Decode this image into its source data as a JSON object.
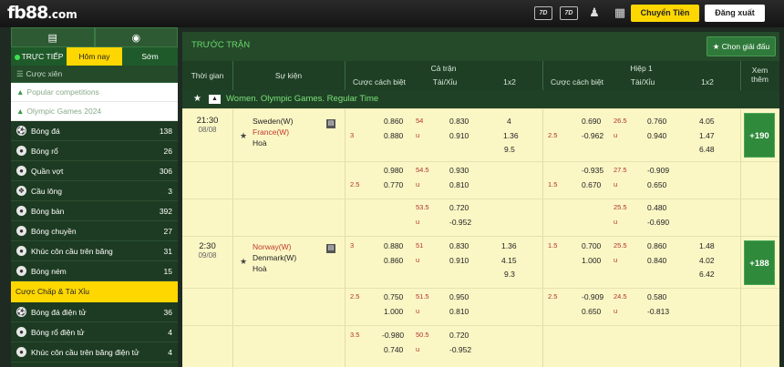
{
  "header": {
    "logo_main": "fb88",
    "logo_suffix": ".com",
    "icon1_label": "7D",
    "icon2_label": "7D",
    "transfer_label": "Chuyển Tiền",
    "logout_label": "Đăng xuất"
  },
  "sidebar": {
    "tabs": [
      {
        "label": "TRỰC TIẾP"
      },
      {
        "label": "Hôm nay"
      },
      {
        "label": "Sớm"
      }
    ],
    "mixed_label": "Cược xiên",
    "competitions": [
      {
        "label": "Popular competitions"
      },
      {
        "label": "Olympic Games 2024"
      }
    ],
    "sports": [
      {
        "label": "Bóng đá",
        "count": "138"
      },
      {
        "label": "Bóng rổ",
        "count": "26"
      },
      {
        "label": "Quần vợt",
        "count": "306"
      },
      {
        "label": "Cầu lông",
        "count": "3"
      },
      {
        "label": "Bóng bàn",
        "count": "392"
      },
      {
        "label": "Bóng chuyền",
        "count": "27"
      },
      {
        "label": "Khúc côn cầu trên băng",
        "count": "31"
      },
      {
        "label": "Bóng ném",
        "count": "15"
      }
    ],
    "section_label": "Cược Chấp & Tài Xỉu",
    "esports": [
      {
        "label": "Bóng đá điện tử",
        "count": "36"
      },
      {
        "label": "Bóng rổ điện tử",
        "count": "4"
      },
      {
        "label": "Khúc côn cầu trên băng điện tử",
        "count": "4"
      }
    ]
  },
  "main": {
    "title": "TRƯỚC TRẬN",
    "pick_label": "Chọn giải đấu",
    "headers": {
      "time": "Thời gian",
      "event": "Sự kiện",
      "full_match": "Cả trận",
      "half": "Hiệp 1",
      "handicap": "Cược cách biệt",
      "over_under": "Tài/Xỉu",
      "one_x_two": "1x2",
      "more_line1": "Xem",
      "more_line2": "thêm"
    },
    "league": "Women. Olympic Games. Regular Time",
    "matches": [
      {
        "time": "21:30",
        "date": "08/08",
        "home": "Sweden(W)",
        "away": "France(W)",
        "draw": "Hoà",
        "more": "+190",
        "lines": [
          {
            "ft_hcp": "3",
            "ft_hcp_h": "0.860",
            "ft_hcp_a": "0.880",
            "ft_ou": "54",
            "ft_ou_u": "u",
            "ft_ou_h": "0.830",
            "ft_ou_a": "0.910",
            "ft_1": "4",
            "ft_x": "1.36",
            "ft_2": "9.5",
            "h1_hcp": "2.5",
            "h1_hcp_h": "0.690",
            "h1_hcp_a": "-0.962",
            "h1_ou": "26.5",
            "h1_ou_u": "u",
            "h1_ou_h": "0.760",
            "h1_ou_a": "0.940",
            "h1_1": "4.05",
            "h1_x": "1.47",
            "h1_2": "6.48"
          },
          {
            "ft_hcp": "2.5",
            "ft_hcp_h": "0.980",
            "ft_hcp_a": "0.770",
            "ft_ou": "54.5",
            "ft_ou_u": "u",
            "ft_ou_h": "0.930",
            "ft_ou_a": "0.810",
            "h1_hcp": "1.5",
            "h1_hcp_h": "-0.935",
            "h1_hcp_a": "0.670",
            "h1_ou": "27.5",
            "h1_ou_u": "u",
            "h1_ou_h": "-0.909",
            "h1_ou_a": "0.650"
          },
          {
            "ft_ou": "53.5",
            "ft_ou_u": "u",
            "ft_ou_h": "0.720",
            "ft_ou_a": "-0.952",
            "h1_ou": "25.5",
            "h1_ou_u": "u",
            "h1_ou_h": "0.480",
            "h1_ou_a": "-0.690"
          }
        ]
      },
      {
        "time": "2:30",
        "date": "09/08",
        "home": "Norway(W)",
        "away": "Denmark(W)",
        "draw": "Hoà",
        "more": "+188",
        "lines": [
          {
            "ft_hcp": "3",
            "ft_hcp_h": "0.880",
            "ft_hcp_a": "0.860",
            "ft_ou": "51",
            "ft_ou_u": "u",
            "ft_ou_h": "0.830",
            "ft_ou_a": "0.910",
            "ft_1": "1.36",
            "ft_x": "4.15",
            "ft_2": "9.3",
            "h1_hcp": "1.5",
            "h1_hcp_h": "0.700",
            "h1_hcp_a": "1.000",
            "h1_ou": "25.5",
            "h1_ou_u": "u",
            "h1_ou_h": "0.860",
            "h1_ou_a": "0.840",
            "h1_1": "1.48",
            "h1_x": "4.02",
            "h1_2": "6.42"
          },
          {
            "ft_hcp": "2.5",
            "ft_hcp_h": "0.750",
            "ft_hcp_a": "1.000",
            "ft_ou": "51.5",
            "ft_ou_u": "u",
            "ft_ou_h": "0.950",
            "ft_ou_a": "0.810",
            "h1_hcp": "2.5",
            "h1_hcp_h": "-0.909",
            "h1_hcp_a": "0.650",
            "h1_ou": "24.5",
            "h1_ou_u": "u",
            "h1_ou_h": "0.580",
            "h1_ou_a": "-0.813"
          },
          {
            "ft_hcp": "3.5",
            "ft_hcp_h": "-0.980",
            "ft_hcp_a": "0.740",
            "ft_ou": "50.5",
            "ft_ou_u": "u",
            "ft_ou_h": "0.720",
            "ft_ou_a": "-0.952"
          }
        ]
      }
    ]
  }
}
